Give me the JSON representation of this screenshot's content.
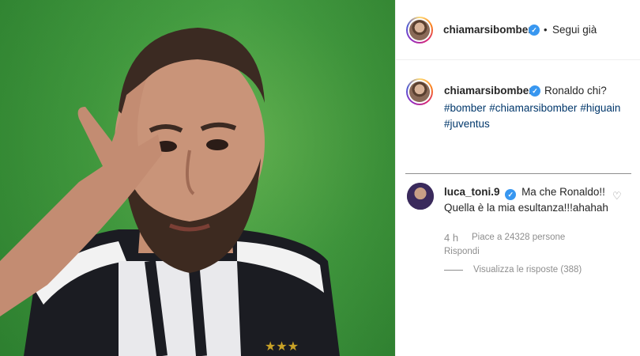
{
  "post": {
    "author": {
      "username": "chiamarsibomber",
      "verified": true,
      "follow_status": "Segui già",
      "separator": "•"
    },
    "caption": {
      "text": "Ronaldo chi?",
      "hashtags": [
        "#bomber",
        "#chiamarsibomber",
        "#higuain",
        "#juventus"
      ]
    },
    "comment": {
      "username": "luca_toni.9",
      "verified": true,
      "text": "Ma che Ronaldo!! Quella è la mia esultanza!!!ahahah",
      "time": "4 h",
      "likes": "Piace a 24328 persone",
      "reply_label": "Rispondi",
      "view_replies_label": "Visualizza le risposte (388)"
    }
  },
  "icons": {
    "verified": "verified-badge-icon",
    "like": "heart-outline-icon"
  },
  "colors": {
    "link": "#00376b",
    "verified": "#3897f0",
    "muted": "#8e8e8e",
    "pitch_green": "#3f9a3c"
  }
}
